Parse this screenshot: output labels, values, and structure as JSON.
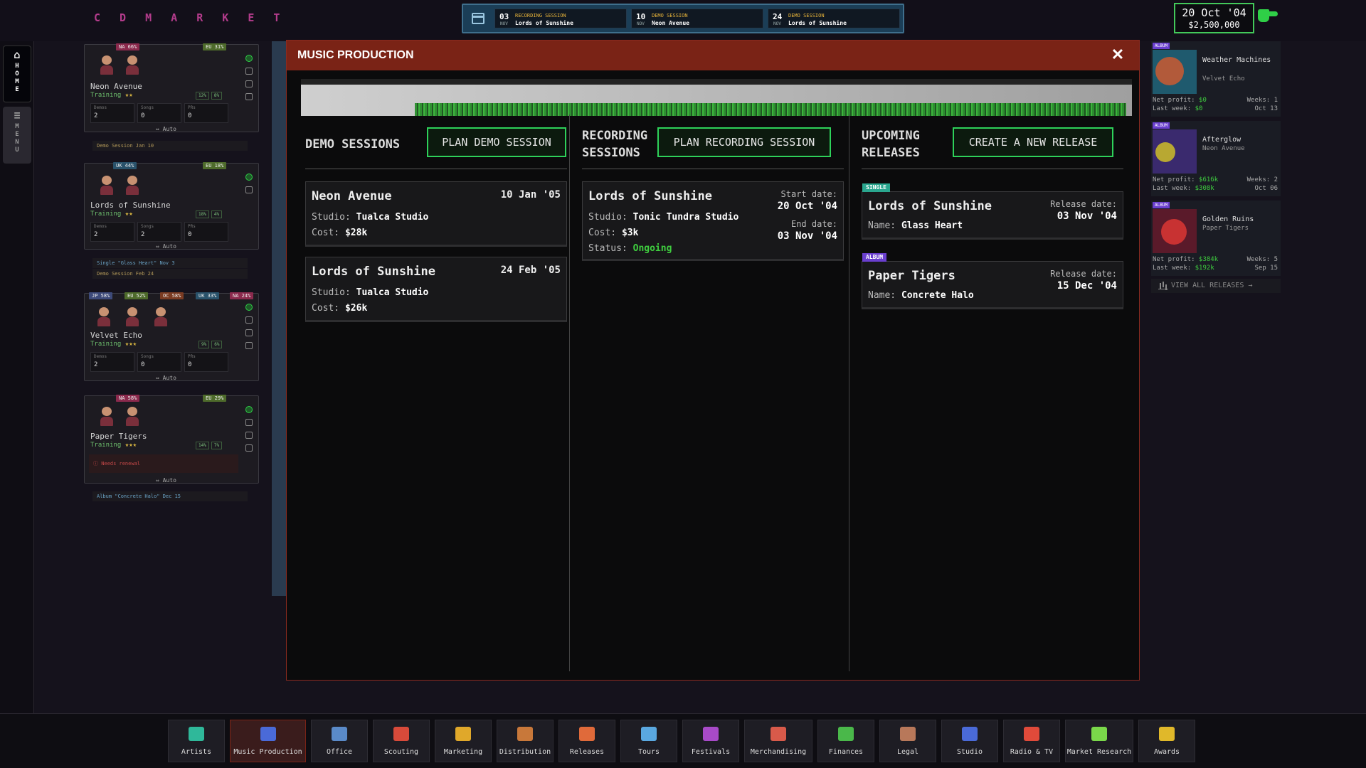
{
  "app": {
    "logo": "C D  M A R K E T"
  },
  "header": {
    "events": [
      {
        "day": "03",
        "month": "NOV",
        "type": "RECORDING SESSION",
        "name": "Lords of Sunshine"
      },
      {
        "day": "10",
        "month": "NOV",
        "type": "DEMO SESSION",
        "name": "Neon Avenue"
      },
      {
        "day": "24",
        "month": "NOV",
        "type": "DEMO SESSION",
        "name": "Lords of Sunshine"
      }
    ],
    "date": "20 Oct '04",
    "money": "$2,500,000"
  },
  "sidebar": {
    "home_label": "HOME",
    "menu_label": "MENU"
  },
  "roster": [
    {
      "name": "Neon Avenue",
      "status": "Training",
      "stars": "★★",
      "regions": [
        {
          "label": "NA 66%",
          "cls": "r-na"
        },
        {
          "label": "EU 31%",
          "cls": "r-eu"
        }
      ],
      "stat_a": "12%",
      "stat_b": "8%",
      "demos_label": "Demos",
      "demos": "2",
      "songs_label": "Songs",
      "songs": "0",
      "prs_label": "PRs",
      "prs": "0",
      "auto": "Auto",
      "notes": [
        {
          "text": "Demo Session Jan 10",
          "cls": ""
        }
      ]
    },
    {
      "name": "Lords of Sunshine",
      "status": "Training",
      "stars": "★★",
      "regions": [
        {
          "label": "UK 44%",
          "cls": "r-uk"
        },
        {
          "label": "EU 18%",
          "cls": "r-eu"
        }
      ],
      "stat_a": "18%",
      "stat_b": "4%",
      "demos_label": "Demos",
      "demos": "2",
      "songs_label": "Songs",
      "songs": "2",
      "prs_label": "PRs",
      "prs": "0",
      "auto": "Auto",
      "notes": [
        {
          "text": "Single \"Glass Heart\" Nov 3",
          "cls": "single"
        },
        {
          "text": "Demo Session Feb 24",
          "cls": ""
        }
      ]
    },
    {
      "name": "Velvet Echo",
      "status": "Training",
      "stars": "★★★",
      "regions": [
        {
          "label": "JP 58%",
          "cls": "r-jp"
        },
        {
          "label": "EU 52%",
          "cls": "r-eu"
        },
        {
          "label": "OC 58%",
          "cls": "r-oc"
        },
        {
          "label": "UK 33%",
          "cls": "r-uk"
        },
        {
          "label": "NA 24%",
          "cls": "r-na"
        }
      ],
      "stat_a": "9%",
      "stat_b": "6%",
      "demos_label": "Demos",
      "demos": "2",
      "songs_label": "Songs",
      "songs": "0",
      "prs_label": "PRs",
      "prs": "0",
      "auto": "Auto",
      "notes": []
    },
    {
      "name": "Paper Tigers",
      "status": "Training",
      "stars": "★★★",
      "regions": [
        {
          "label": "NA 58%",
          "cls": "r-na"
        },
        {
          "label": "EU 29%",
          "cls": "r-eu"
        }
      ],
      "stat_a": "14%",
      "stat_b": "7%",
      "warning": "Needs renewal",
      "auto": "Auto",
      "notes": [
        {
          "text": "Album \"Concrete Halo\" Dec 15",
          "cls": "single"
        }
      ]
    }
  ],
  "modal": {
    "title": "MUSIC PRODUCTION",
    "close": "✕",
    "demo": {
      "title_line1": "DEMO SESSIONS",
      "button": "PLAN DEMO SESSION",
      "cards": [
        {
          "artist": "Neon Avenue",
          "date": "10 Jan '05",
          "studio_label": "Studio:",
          "studio": "Tualca Studio",
          "cost_label": "Cost:",
          "cost": "$28k"
        },
        {
          "artist": "Lords of Sunshine",
          "date": "24 Feb '05",
          "studio_label": "Studio:",
          "studio": "Tualca Studio",
          "cost_label": "Cost:",
          "cost": "$26k"
        }
      ]
    },
    "recording": {
      "title_line1": "RECORDING",
      "title_line2": "SESSIONS",
      "button": "PLAN RECORDING SESSION",
      "cards": [
        {
          "artist": "Lords of Sunshine",
          "studio_label": "Studio:",
          "studio": "Tonic Tundra Studio",
          "cost_label": "Cost:",
          "cost": "$3k",
          "status_label": "Status:",
          "status": "Ongoing",
          "start_label": "Start date:",
          "start": "20 Oct '04",
          "end_label": "End date:",
          "end": "03 Nov '04"
        }
      ]
    },
    "upcoming": {
      "title_line1": "UPCOMING",
      "title_line2": "RELEASES",
      "button": "CREATE A NEW RELEASE",
      "cards": [
        {
          "tag": "SINGLE",
          "artist": "Lords of Sunshine",
          "name_label": "Name:",
          "name": "Glass Heart",
          "release_label": "Release date:",
          "release": "03 Nov '04"
        },
        {
          "tag": "ALBUM",
          "artist": "Paper Tigers",
          "name_label": "Name:",
          "name": "Concrete Halo",
          "release_label": "Release date:",
          "release": "15 Dec '04"
        }
      ]
    }
  },
  "releases": [
    {
      "tag": "ALBUM",
      "title": "Weather Machines",
      "artist": "Velvet Echo",
      "np_label": "Net profit:",
      "np": "$0",
      "lw_label": "Last week:",
      "lw": "$0",
      "weeks_label": "Weeks:",
      "weeks": "1",
      "date": "Oct 13",
      "c1": "#1f5a6e",
      "c2": "#b25a3a"
    },
    {
      "tag": "ALBUM",
      "title": "Afterglow",
      "artist": "Neon Avenue",
      "np_label": "Net profit:",
      "np": "$616k",
      "lw_label": "Last week:",
      "lw": "$308k",
      "weeks_label": "Weeks:",
      "weeks": "2",
      "date": "Oct 06",
      "c1": "#3a2a6e",
      "c2": "#b8a832"
    },
    {
      "tag": "ALBUM",
      "title": "Golden Ruins",
      "artist": "Paper Tigers",
      "np_label": "Net profit:",
      "np": "$384k",
      "lw_label": "Last week:",
      "lw": "$192k",
      "weeks_label": "Weeks:",
      "weeks": "5",
      "date": "Sep 15",
      "c1": "#5a1a2a",
      "c2": "#c83232"
    }
  ],
  "view_all": "VIEW ALL RELEASES",
  "nav": [
    {
      "label": "Artists",
      "icon": "artists-icon",
      "color": "#2fb89a"
    },
    {
      "label": "Music Production",
      "icon": "music-production-icon",
      "color": "#4a6ad8"
    },
    {
      "label": "Office",
      "icon": "office-icon",
      "color": "#5a8ac8"
    },
    {
      "label": "Scouting",
      "icon": "scouting-icon",
      "color": "#d84a3a"
    },
    {
      "label": "Marketing",
      "icon": "marketing-icon",
      "color": "#e0a82a"
    },
    {
      "label": "Distribution",
      "icon": "distribution-icon",
      "color": "#c8783a"
    },
    {
      "label": "Releases",
      "icon": "releases-icon",
      "color": "#e06a3a"
    },
    {
      "label": "Tours",
      "icon": "tours-icon",
      "color": "#5aa8e0"
    },
    {
      "label": "Festivals",
      "icon": "festivals-icon",
      "color": "#a84ac8"
    },
    {
      "label": "Merchandising",
      "icon": "merchandising-icon",
      "color": "#d85a4a"
    },
    {
      "label": "Finances",
      "icon": "finances-icon",
      "color": "#4ab84a"
    },
    {
      "label": "Legal",
      "icon": "legal-icon",
      "color": "#b8785a"
    },
    {
      "label": "Studio",
      "icon": "studio-icon",
      "color": "#4a6ad8"
    },
    {
      "label": "Radio & TV",
      "icon": "radio-tv-icon",
      "color": "#e04a3a"
    },
    {
      "label": "Market Research",
      "icon": "market-research-icon",
      "color": "#7ad84a"
    },
    {
      "label": "Awards",
      "icon": "awards-icon",
      "color": "#e0b82a"
    }
  ]
}
